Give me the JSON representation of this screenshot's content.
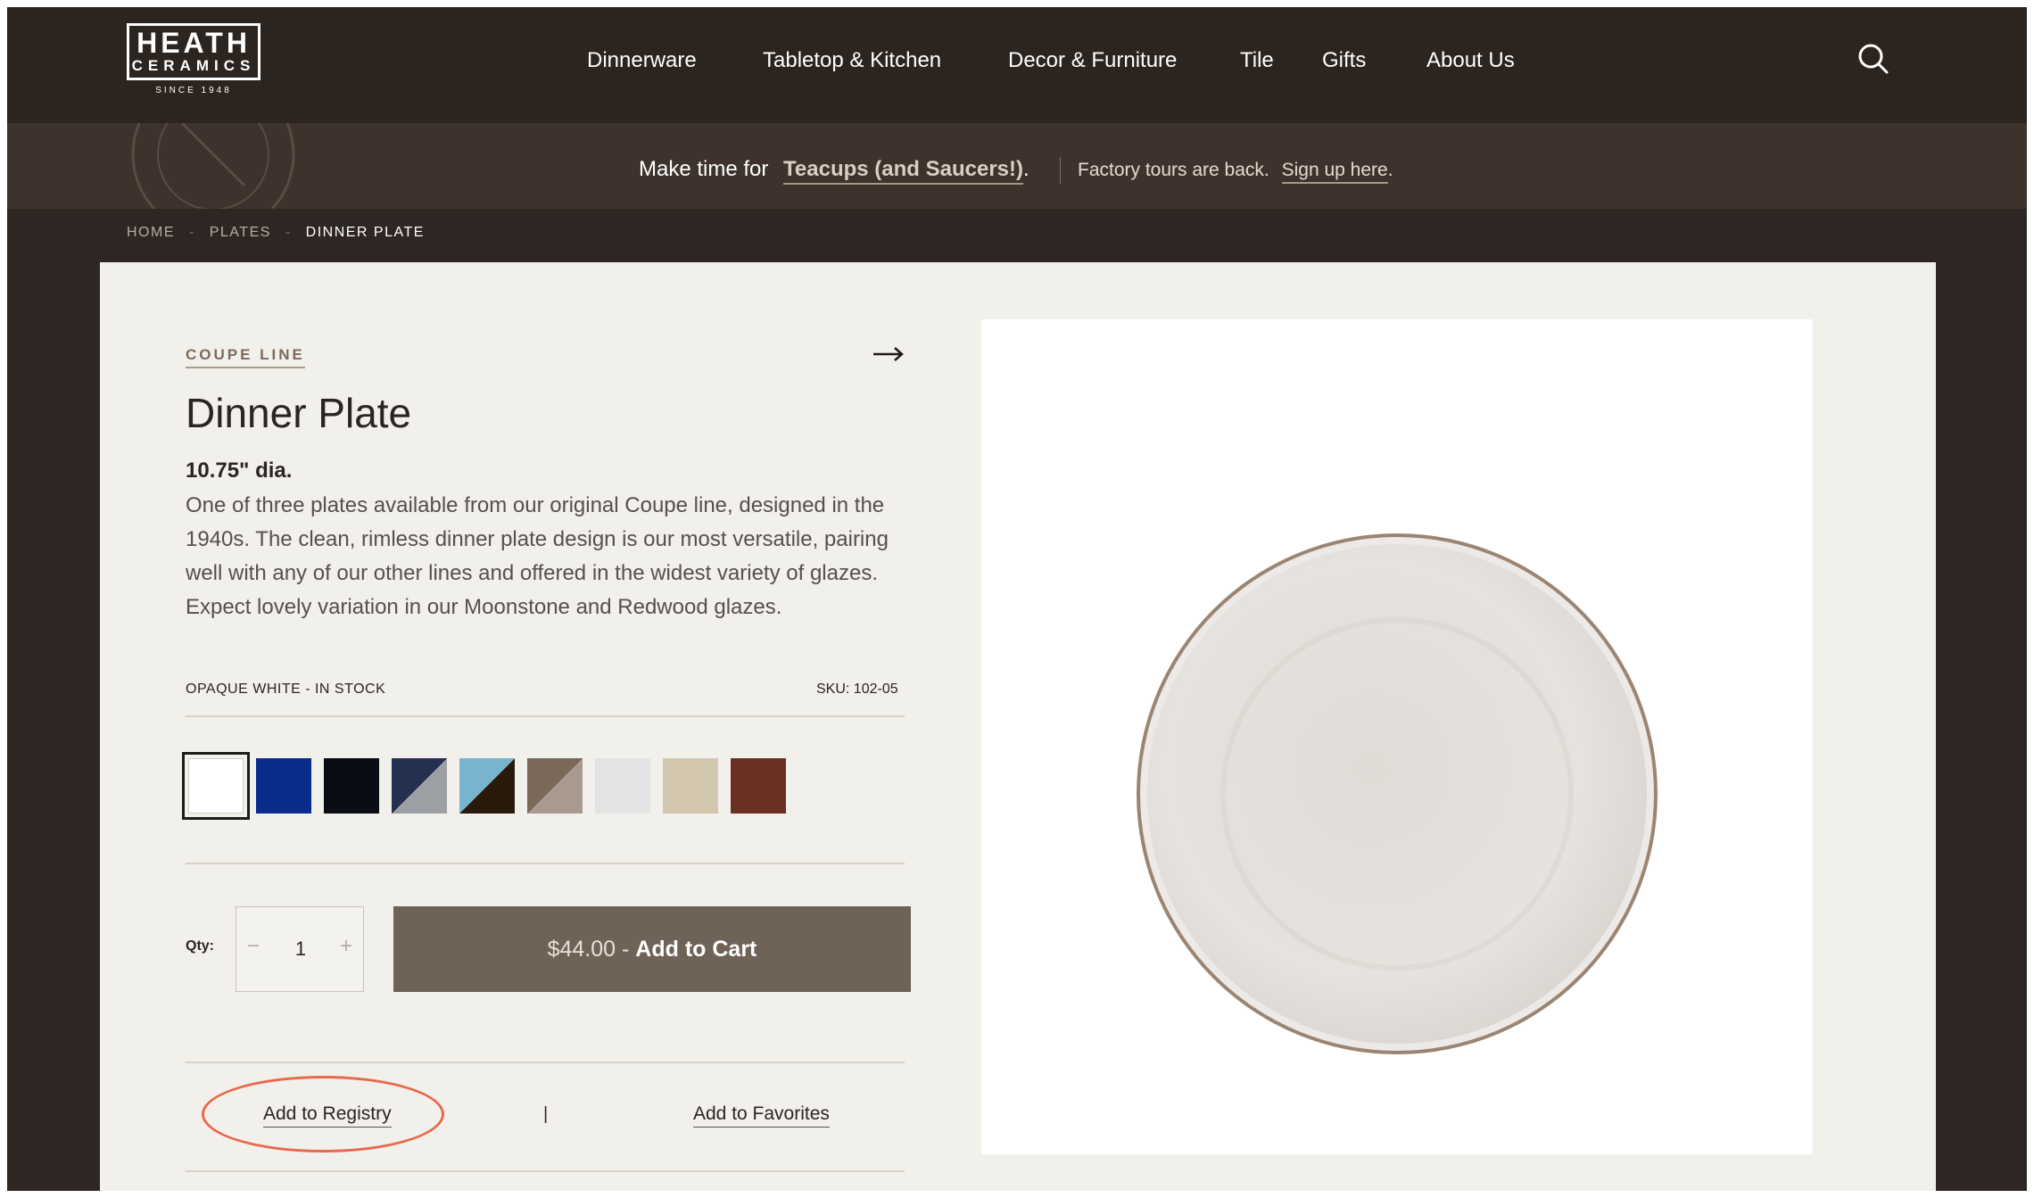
{
  "header": {
    "logo": {
      "line1": "HEATH",
      "line2": "CERAMICS",
      "since": "SINCE 1948"
    },
    "nav": [
      "Dinnerware",
      "Tabletop & Kitchen",
      "Decor & Furniture",
      "Tile",
      "Gifts",
      "About Us"
    ],
    "search_icon": "search-icon"
  },
  "promo": {
    "lead": "Make time for",
    "link": "Teacups (and Saucers!)",
    "link_suffix": ".",
    "secondary": "Factory tours are back.",
    "secondary_link": "Sign up here",
    "secondary_suffix": "."
  },
  "breadcrumb": [
    "HOME",
    "PLATES",
    "DINNER PLATE"
  ],
  "product": {
    "collection": "COUPE LINE",
    "title": "Dinner Plate",
    "dimension": "10.75\" dia.",
    "description": "One of three plates available from our original Coupe line, designed in the 1940s. The clean, rimless dinner plate design is our most versatile, pairing well with any of our other lines and offered in the widest variety of glazes. Expect lovely variation in our Moonstone and Redwood glazes.",
    "glaze_status": "OPAQUE WHITE - IN STOCK",
    "sku": "SKU: 102-05",
    "swatches": [
      {
        "colors": [
          "#ffffff"
        ],
        "selected": true
      },
      {
        "colors": [
          "#0a2d8c"
        ]
      },
      {
        "colors": [
          "#0b0d14"
        ]
      },
      {
        "colors": [
          "#253050",
          "#9da0a5"
        ]
      },
      {
        "colors": [
          "#79b4cf",
          "#2a1a0c"
        ]
      },
      {
        "colors": [
          "#7a6958",
          "#a89a8e"
        ]
      },
      {
        "colors": [
          "#e3e3e3"
        ]
      },
      {
        "colors": [
          "#d3c7ae"
        ]
      },
      {
        "colors": [
          "#6a3024"
        ]
      }
    ],
    "qty_label": "Qty:",
    "qty_value": "1",
    "qty_minus": "−",
    "qty_plus": "+",
    "price": "$44.00",
    "cart_separator": " - ",
    "cart_label": "Add to Cart",
    "registry_label": "Add to Registry",
    "pipe": "|",
    "favorites_label": "Add to Favorites"
  },
  "colors": {
    "header_bg": "#2b241f",
    "promo_bg": "#3d332c",
    "content_bg": "#f2f0eb",
    "cart_button": "#6f6256",
    "highlight_ring": "#e8694a"
  }
}
